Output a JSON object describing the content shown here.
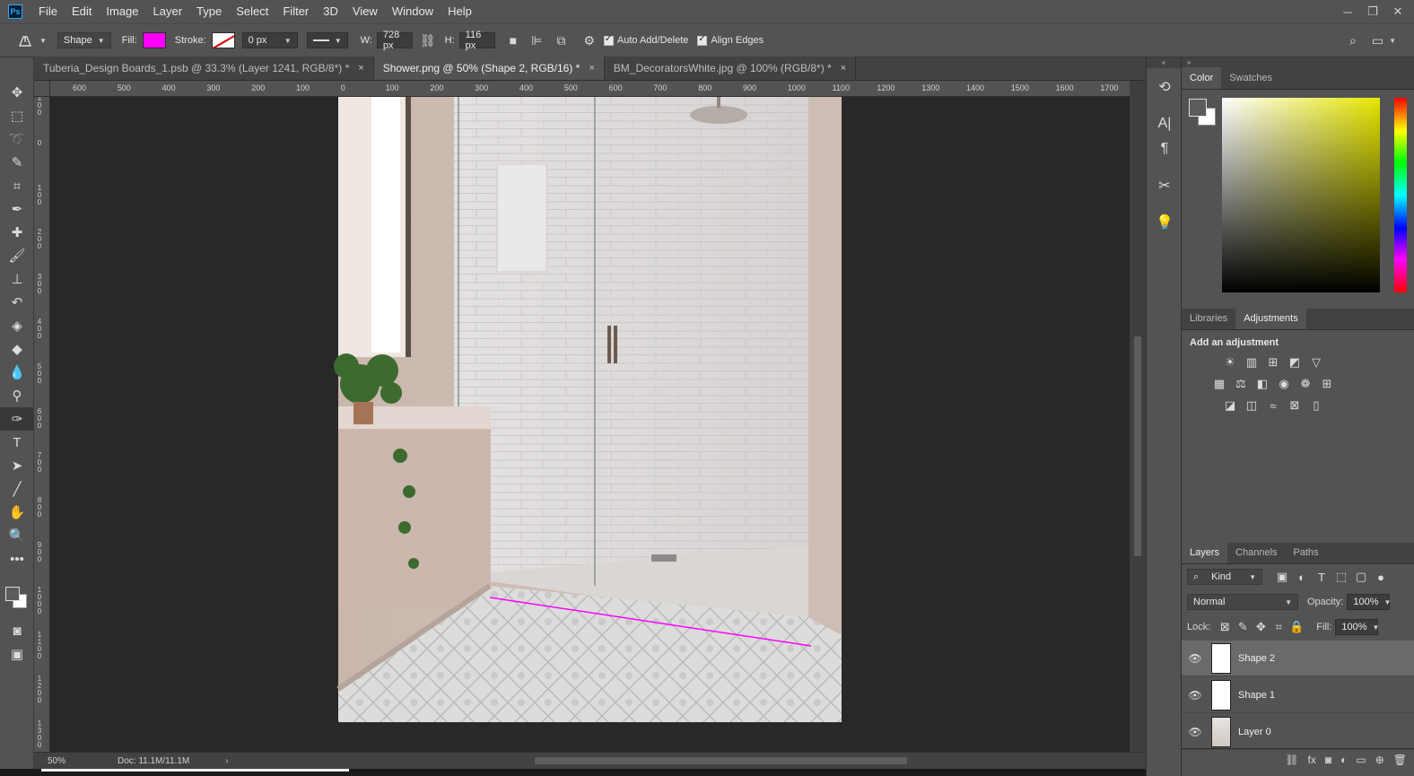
{
  "menu": [
    "File",
    "Edit",
    "Image",
    "Layer",
    "Type",
    "Select",
    "Filter",
    "3D",
    "View",
    "Window",
    "Help"
  ],
  "options": {
    "tool_mode": "Shape",
    "fill_label": "Fill:",
    "fill_color": "#ff00ff",
    "stroke_label": "Stroke:",
    "stroke_width": "0 px",
    "w_label": "W:",
    "w_value": "728 px",
    "h_label": "H:",
    "h_value": "116 px",
    "auto_add_delete": "Auto Add/Delete",
    "align_edges": "Align Edges"
  },
  "tabs": [
    {
      "label": "Tuberia_Design Boards_1.psb @ 33.3% (Layer 1241, RGB/8*) *",
      "active": false
    },
    {
      "label": "Shower.png @ 50% (Shape 2, RGB/16) *",
      "active": true
    },
    {
      "label": "BM_DecoratorsWhite.jpg @ 100% (RGB/8*) *",
      "active": false
    }
  ],
  "tab_close": "×",
  "ruler_h": [
    "600",
    "500",
    "400",
    "300",
    "200",
    "100",
    "0",
    "100",
    "200",
    "300",
    "400",
    "500",
    "600",
    "700",
    "800",
    "900",
    "1000",
    "1100",
    "1200",
    "1300",
    "1400",
    "1500",
    "1600",
    "1700"
  ],
  "ruler_v": [
    "100",
    "0",
    "100",
    "200",
    "300",
    "400",
    "500",
    "600",
    "700",
    "800",
    "900",
    "1000",
    "1100",
    "1200",
    "1300",
    "1400"
  ],
  "status": {
    "zoom": "50%",
    "doc": "Doc: 11.1M/11.1M"
  },
  "color_panel": {
    "tabs": [
      "Color",
      "Swatches"
    ],
    "active": "Color"
  },
  "adjust_panel": {
    "tabs": [
      "Libraries",
      "Adjustments"
    ],
    "active": "Adjustments",
    "title": "Add an adjustment"
  },
  "layers_panel": {
    "tabs": [
      "Layers",
      "Channels",
      "Paths"
    ],
    "active": "Layers",
    "kind": "Kind",
    "blend_mode": "Normal",
    "opacity_label": "Opacity:",
    "opacity": "100%",
    "lock_label": "Lock:",
    "fill_label": "Fill:",
    "fill": "100%",
    "layers": [
      {
        "name": "Shape 2",
        "selected": true
      },
      {
        "name": "Shape 1",
        "selected": false
      },
      {
        "name": "Layer 0",
        "selected": false
      }
    ]
  }
}
